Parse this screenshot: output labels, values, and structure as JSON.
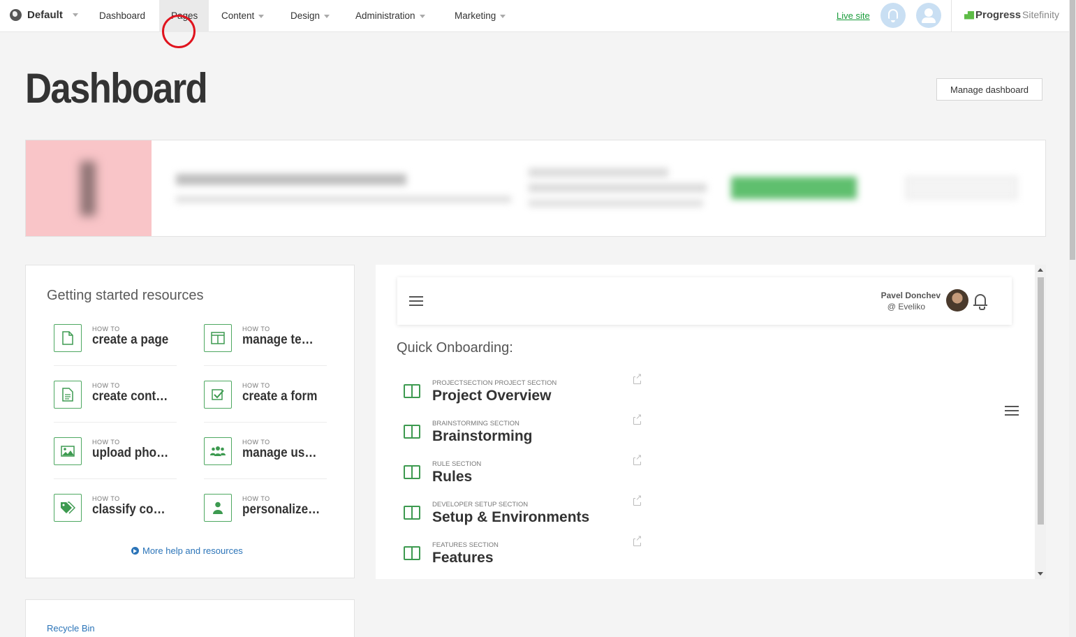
{
  "nav": {
    "site": "Default",
    "items": [
      "Dashboard",
      "Pages",
      "Content",
      "Design",
      "Administration",
      "Marketing"
    ],
    "live_site": "Live site",
    "logo_progress": "Progress",
    "logo_sitefinity": "Sitefinity"
  },
  "page_title": "Dashboard",
  "manage_dashboard": "Manage dashboard",
  "getting_started": {
    "title": "Getting started resources",
    "items": [
      {
        "small": "HOW TO",
        "big": "create a page",
        "icon": "page-icon"
      },
      {
        "small": "HOW TO",
        "big": "manage templates",
        "icon": "template-icon"
      },
      {
        "small": "HOW TO",
        "big": "create content",
        "icon": "document-icon"
      },
      {
        "small": "HOW TO",
        "big": "create a form",
        "icon": "checkbox-icon"
      },
      {
        "small": "HOW TO",
        "big": "upload photos",
        "icon": "image-icon"
      },
      {
        "small": "HOW TO",
        "big": "manage users",
        "icon": "users-icon"
      },
      {
        "small": "HOW TO",
        "big": "classify content",
        "icon": "tag-icon"
      },
      {
        "small": "HOW TO",
        "big": "personalize pages",
        "icon": "person-icon"
      }
    ],
    "more_help": "More help and resources"
  },
  "recycle_bin": "Recycle Bin",
  "widget": {
    "user_name": "Pavel Donchev",
    "user_handle": "@ Eveliko",
    "quick_title": "Quick Onboarding:",
    "sections": [
      {
        "small": "PROJECTSECTION PROJECT SECTION",
        "big": "Project Overview"
      },
      {
        "small": "BRAINSTORMING SECTION",
        "big": "Brainstorming"
      },
      {
        "small": "RULE SECTION",
        "big": "Rules"
      },
      {
        "small": "DEVELOPER SETUP SECTION",
        "big": "Setup & Environments"
      },
      {
        "small": "FEATURES SECTION",
        "big": "Features"
      }
    ]
  },
  "colors": {
    "accent_green": "#3d9a50",
    "link_blue": "#2b74b8",
    "live_green": "#1a9c3b"
  }
}
